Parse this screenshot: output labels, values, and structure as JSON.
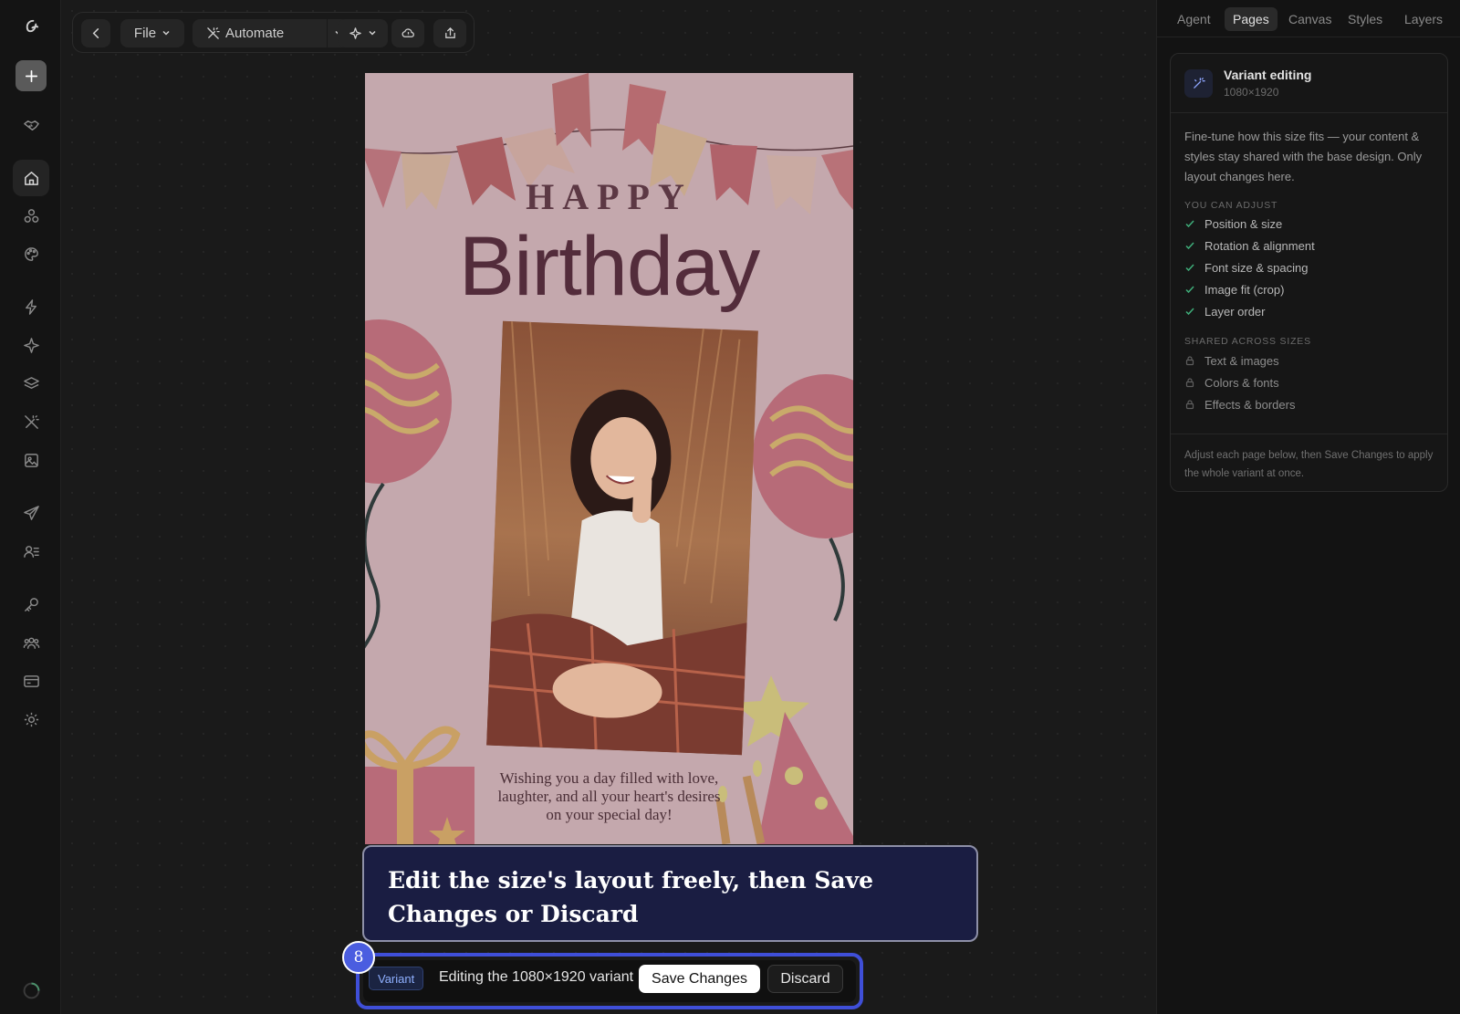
{
  "toolbar": {
    "file_label": "File",
    "automate_label": "Automate"
  },
  "artboard": {
    "happy": "HAPPY",
    "birthday": "Birthday",
    "message_line1": "Wishing you a day filled with love,",
    "message_line2": "laughter, and all your heart's desires",
    "message_line3": "on your special day!"
  },
  "tooltip": {
    "text": "Edit the size's layout freely, then Save Changes or Discard"
  },
  "step_badge": "8",
  "variant_bar": {
    "tag": "Variant",
    "text": "Editing the 1080×1920 variant",
    "save_label": "Save Changes",
    "discard_label": "Discard"
  },
  "panel": {
    "tabs": [
      {
        "label": "Agent"
      },
      {
        "label": "Pages"
      },
      {
        "label": "Canvas"
      },
      {
        "label": "Styles"
      },
      {
        "label": "Layers"
      }
    ],
    "active_tab": "Pages",
    "card": {
      "title": "Variant editing",
      "subtitle": "1080×1920",
      "description": "Fine-tune how this size fits — your content & styles stay shared with the base design. Only layout changes here.",
      "adjust_heading": "YOU CAN ADJUST",
      "adjust_items": [
        {
          "label": "Position & size"
        },
        {
          "label": "Rotation & alignment"
        },
        {
          "label": "Font size & spacing"
        },
        {
          "label": "Image fit (crop)"
        },
        {
          "label": "Layer order"
        }
      ],
      "shared_heading": "SHARED ACROSS SIZES",
      "shared_items": [
        {
          "label": "Text & images"
        },
        {
          "label": "Colors & fonts"
        },
        {
          "label": "Effects & borders"
        }
      ],
      "footer": "Adjust each page below, then Save Changes to apply the whole variant at once."
    }
  },
  "colors": {
    "accent": "#3f4fd8",
    "tooltip_bg": "#1a1d42",
    "check": "#3fae7a"
  }
}
